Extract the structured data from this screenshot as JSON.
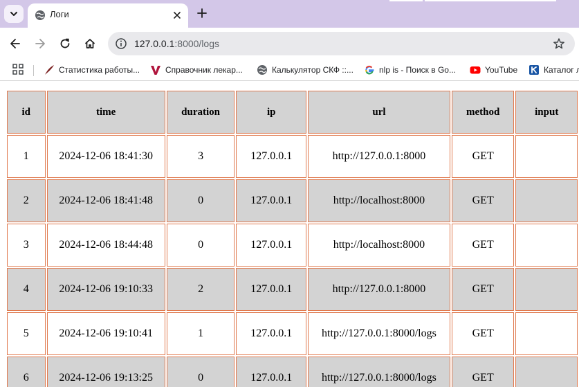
{
  "browser": {
    "tab_title": "Логи",
    "url_host": "127.0.0.1",
    "url_path": ":8000/logs",
    "colors": {
      "tabstrip": "#d3c7e8",
      "youtube": "#ff0000"
    }
  },
  "bookmarks": [
    {
      "label": "Статистика работы...",
      "icon": "feather-icon"
    },
    {
      "label": "Справочник лекар...",
      "icon": "v-logo-icon"
    },
    {
      "label": "Калькулятор СКФ ::...",
      "icon": "globe-icon"
    },
    {
      "label": "nlp is - Поиск в Go...",
      "icon": "google-icon"
    },
    {
      "label": "YouTube",
      "icon": "youtube-icon"
    },
    {
      "label": "Каталог л",
      "icon": "catalog-icon"
    }
  ],
  "table": {
    "headers": [
      "id",
      "time",
      "duration",
      "ip",
      "url",
      "method",
      "input"
    ],
    "rows": [
      [
        "1",
        "2024-12-06 18:41:30",
        "3",
        "127.0.0.1",
        "http://127.0.0.1:8000",
        "GET",
        ""
      ],
      [
        "2",
        "2024-12-06 18:41:48",
        "0",
        "127.0.0.1",
        "http://localhost:8000",
        "GET",
        ""
      ],
      [
        "3",
        "2024-12-06 18:44:48",
        "0",
        "127.0.0.1",
        "http://localhost:8000",
        "GET",
        ""
      ],
      [
        "4",
        "2024-12-06 19:10:33",
        "2",
        "127.0.0.1",
        "http://127.0.0.1:8000",
        "GET",
        ""
      ],
      [
        "5",
        "2024-12-06 19:10:41",
        "1",
        "127.0.0.1",
        "http://127.0.0.1:8000/logs",
        "GET",
        ""
      ],
      [
        "6",
        "2024-12-06 19:13:25",
        "0",
        "127.0.0.1",
        "http://127.0.0.1:8000/logs",
        "GET",
        ""
      ]
    ]
  }
}
